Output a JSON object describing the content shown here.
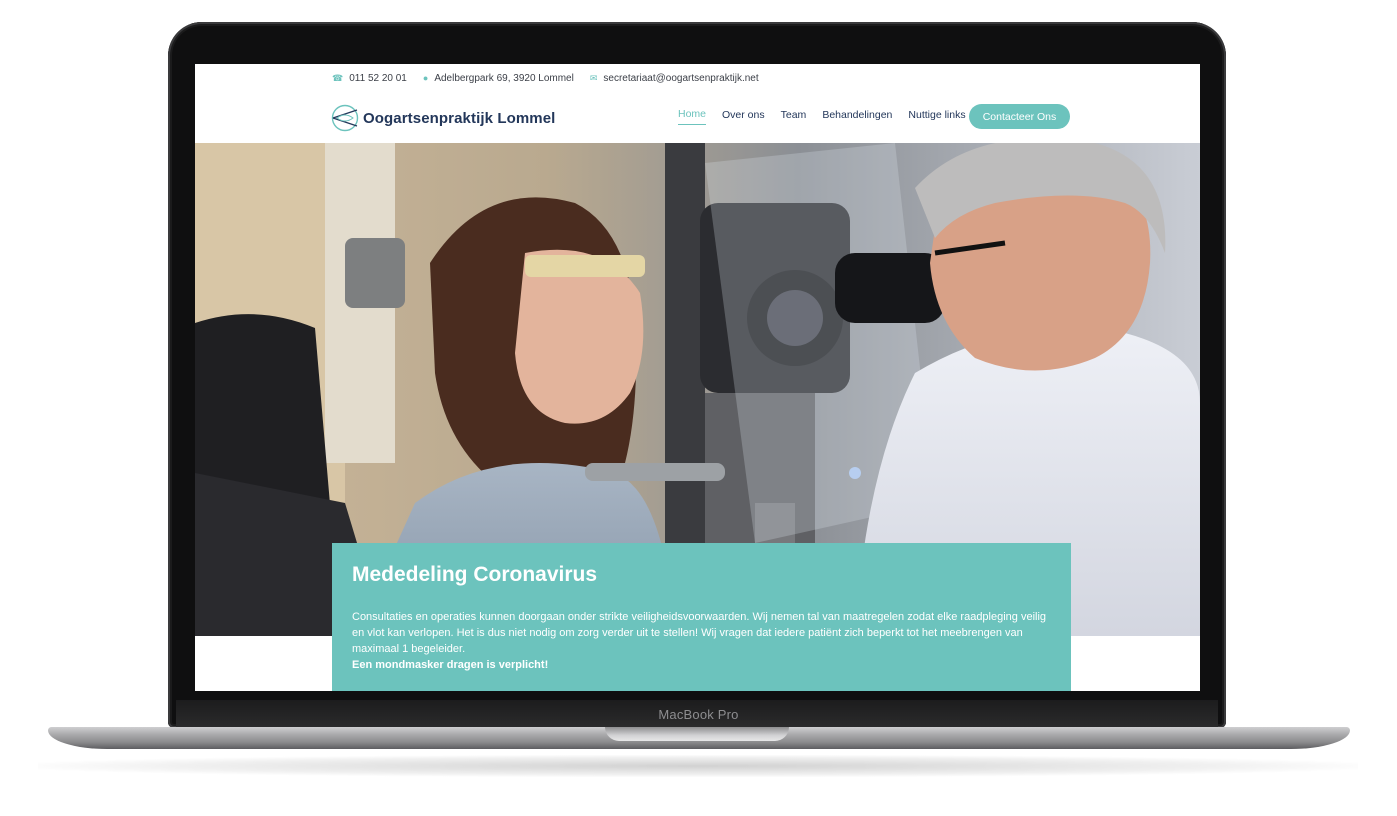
{
  "device": {
    "model_label": "MacBook Pro"
  },
  "topbar": {
    "phone": "011 52 20 01",
    "address": "Adelbergpark 69, 3920 Lommel",
    "email": "secretariaat@oogartsenpraktijk.net"
  },
  "header": {
    "brand": "Oogartsenpraktijk Lommel",
    "nav": [
      {
        "label": "Home",
        "active": true
      },
      {
        "label": "Over ons",
        "active": false
      },
      {
        "label": "Team",
        "active": false
      },
      {
        "label": "Behandelingen",
        "active": false
      },
      {
        "label": "Nuttige links",
        "active": false
      }
    ],
    "cta_label": "Contacteer Ons"
  },
  "notice": {
    "title": "Mededeling Coronavirus",
    "body": "Consultaties en operaties kunnen doorgaan onder strikte veiligheidsvoorwaarden. Wij nemen tal van maatregelen zodat elke raadpleging veilig en vlot kan verlopen. Het is dus niet nodig om zorg verder uit te stellen! Wij vragen dat iedere patiënt zich beperkt tot het meebrengen van maximaal 1 begeleider.",
    "emphasis": "Een mondmasker dragen is verplicht!"
  },
  "colors": {
    "accent": "#6cc3bd",
    "brand_navy": "#23375a"
  }
}
